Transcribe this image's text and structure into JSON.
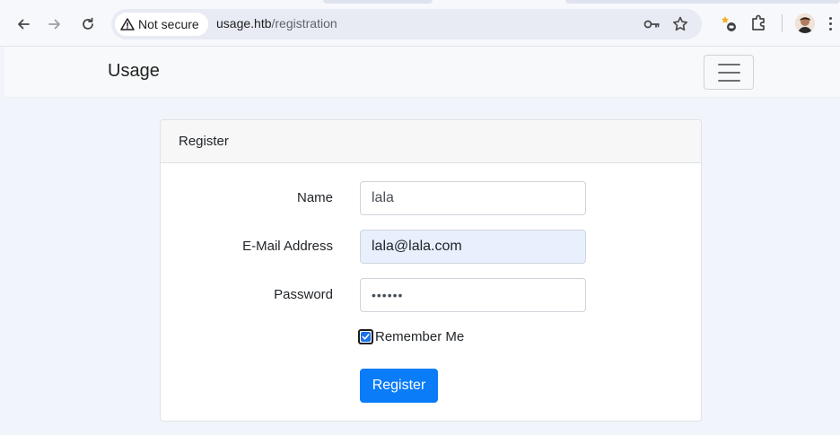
{
  "browser": {
    "security_label": "Not secure",
    "url_host": "usage.htb",
    "url_path": "/registration"
  },
  "navbar": {
    "brand": "Usage"
  },
  "card": {
    "header": "Register",
    "fields": {
      "name_label": "Name",
      "name_value": "lala",
      "email_label": "E-Mail Address",
      "email_value": "lala@lala.com",
      "password_label": "Password",
      "password_value": "••••••"
    },
    "remember_label": "Remember Me",
    "remember_checked": true,
    "submit_label": "Register"
  },
  "colors": {
    "primary": "#0a7cf8",
    "autofill": "#e8f0fe"
  }
}
